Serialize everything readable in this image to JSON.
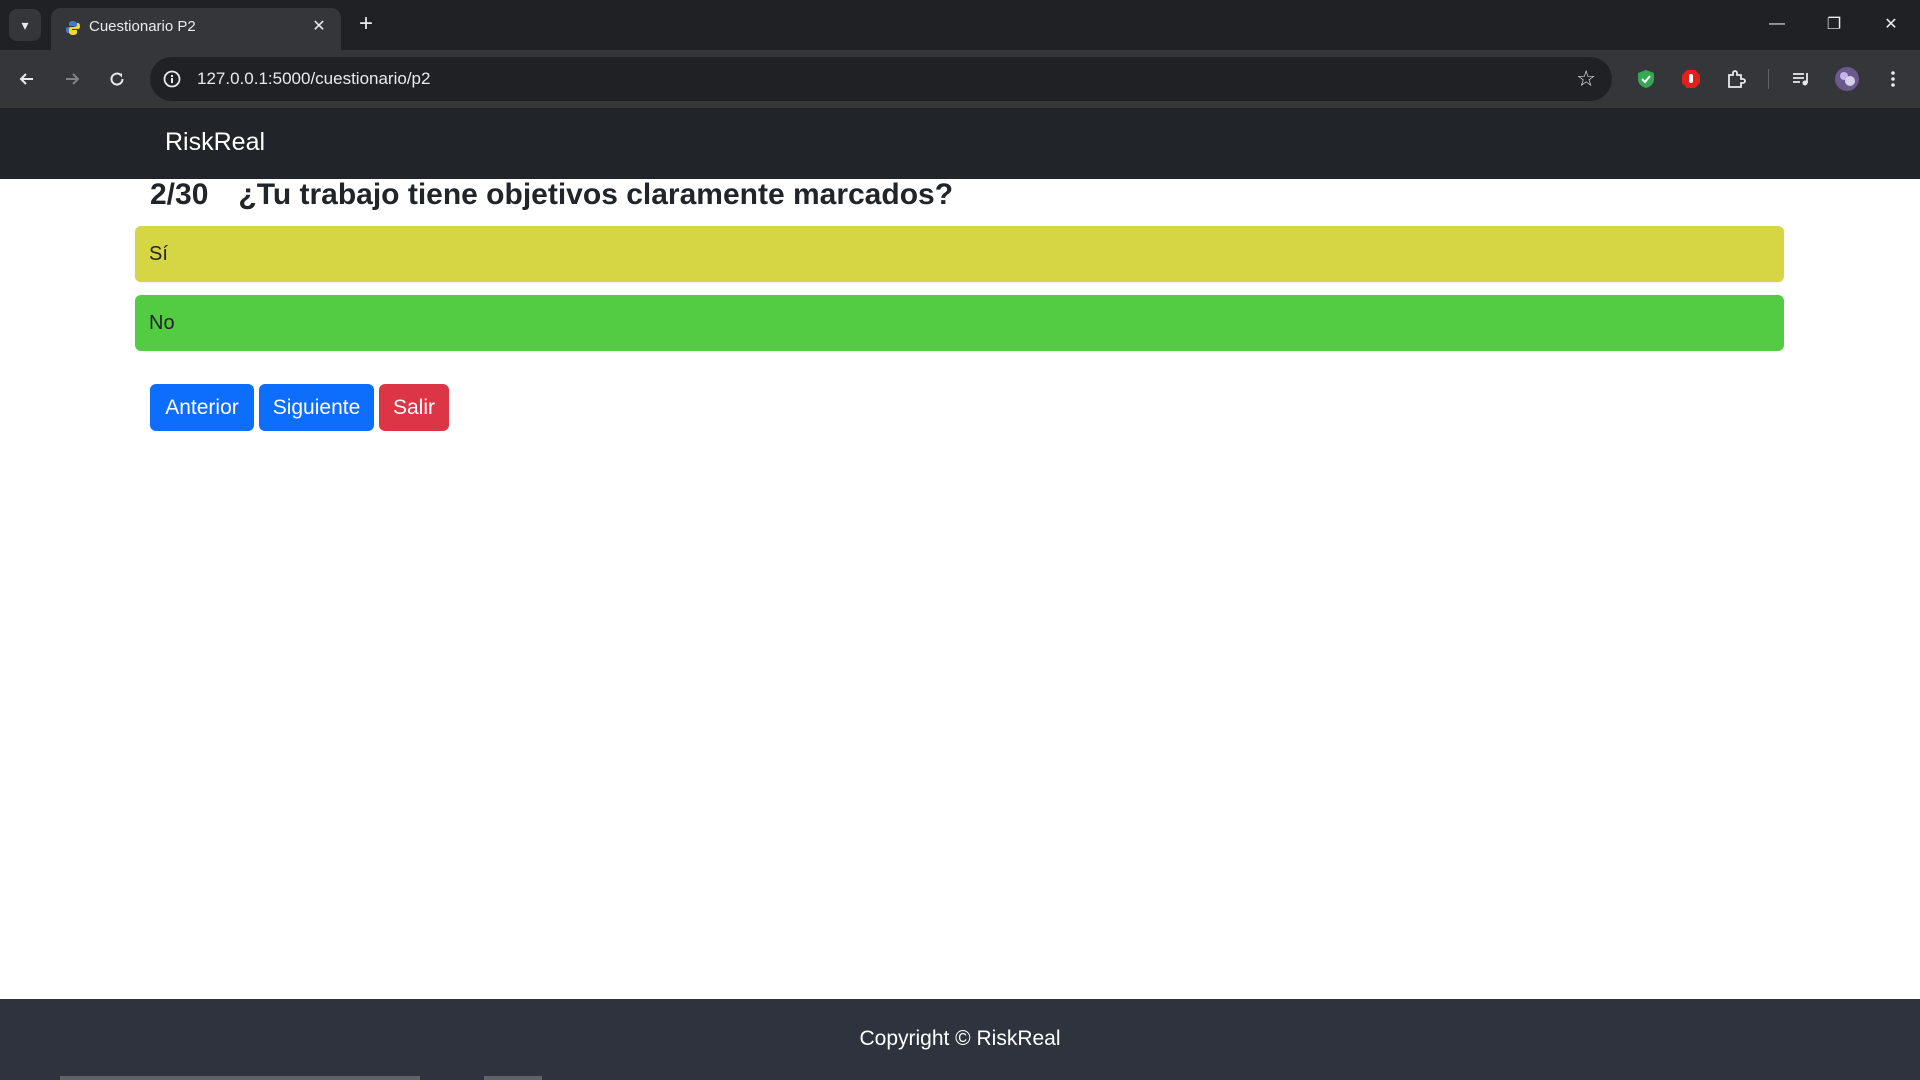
{
  "browser": {
    "tab": {
      "title": "Cuestionario P2",
      "close_glyph": "✕",
      "favicon": "python-favicon"
    },
    "new_tab_glyph": "+",
    "address": {
      "url": "127.0.0.1:5000/cuestionario/p2"
    },
    "window_controls": {
      "minimize": "—",
      "restore": "❐",
      "close": "✕"
    }
  },
  "navbar": {
    "brand": "RiskReal"
  },
  "question": {
    "number": "2/30",
    "text": "¿Tu trabajo tiene objetivos claramente marcados?"
  },
  "options": [
    {
      "label": "Sí",
      "color": "#d6d544"
    },
    {
      "label": "No",
      "color": "#53cb43"
    }
  ],
  "buttons": {
    "previous": "Anterior",
    "next": "Siguiente",
    "exit": "Salir"
  },
  "footer": {
    "text": "Copyright © RiskReal"
  },
  "colors": {
    "primary": "#0d6efd",
    "danger": "#dc3545",
    "navbar": "#212529",
    "footer": "#2e333d"
  }
}
